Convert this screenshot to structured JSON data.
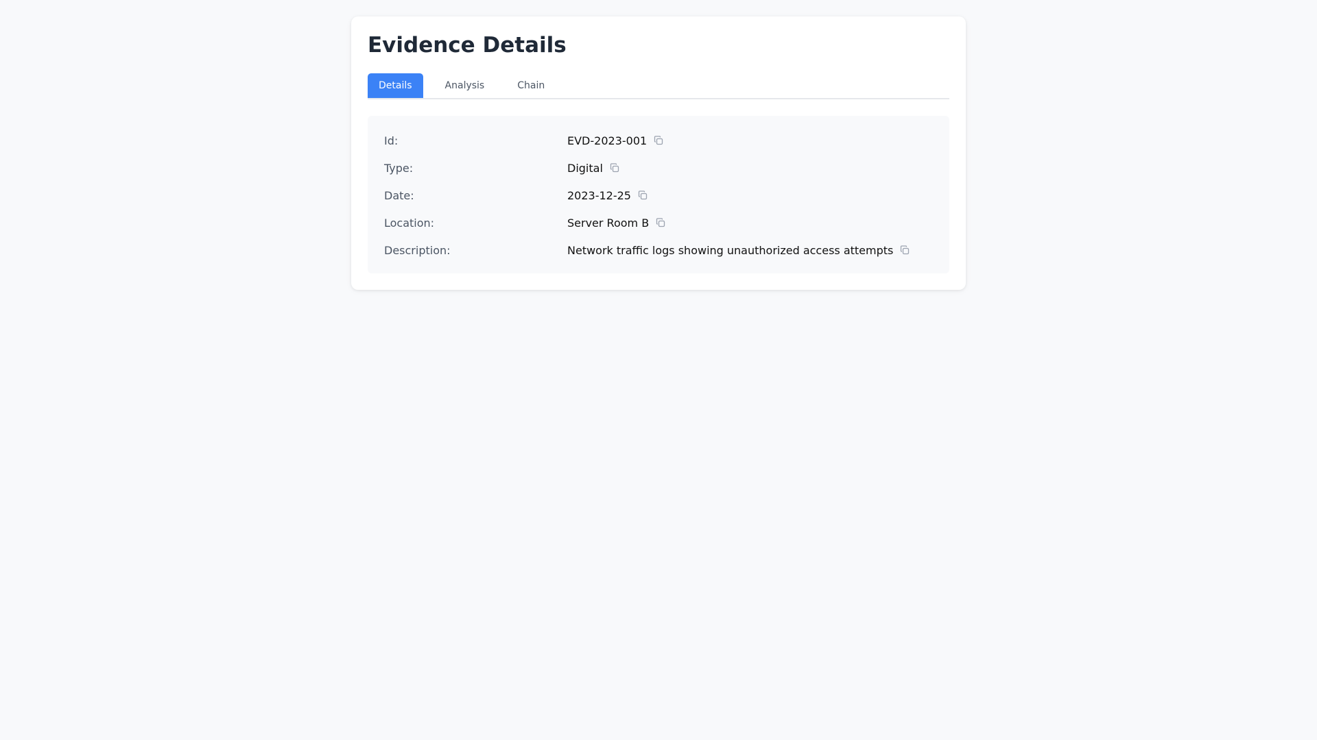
{
  "page": {
    "title": "Evidence Details"
  },
  "tabs": [
    {
      "label": "Details",
      "active": true
    },
    {
      "label": "Analysis",
      "active": false
    },
    {
      "label": "Chain",
      "active": false
    }
  ],
  "fields": [
    {
      "label": "Id:",
      "value": "EVD-2023-001"
    },
    {
      "label": "Type:",
      "value": "Digital"
    },
    {
      "label": "Date:",
      "value": "2023-12-25"
    },
    {
      "label": "Location:",
      "value": "Server Room B"
    },
    {
      "label": "Description:",
      "value": "Network traffic logs showing unauthorized access attempts"
    }
  ],
  "icons": {
    "copy": "copy-icon"
  },
  "colors": {
    "accent": "#3b82f6",
    "background": "#f8f9fb",
    "panel": "#ffffff"
  }
}
